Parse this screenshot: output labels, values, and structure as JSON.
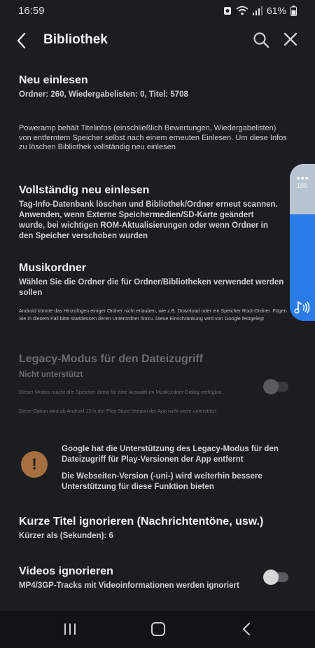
{
  "status": {
    "time": "16:59",
    "battery": "61%"
  },
  "appbar": {
    "title": "Bibliothek"
  },
  "sections": {
    "rescan": {
      "title": "Neu einlesen",
      "summary": "Ordner: 260, Wiedergabelisten: 0, Titel: 5708",
      "note": "Poweramp behält Titelinfos (einschließlich Bewertungen, Wiedergabelisten) von entferntem Speicher selbst nach einem erneuten Einlesen. Um diese Infos zu löschen Bibliothek vollständig neu einlesen"
    },
    "full_rescan": {
      "title": "Vollständig neu einlesen",
      "summary": "Tag-Info-Datenbank löschen und Bibliothek/Ordner erneut scannen. Anwenden, wenn Externe Speichermedien/SD-Karte geändert wurde, bei wichtigen ROM-Aktualisierungen oder wenn Ordner in den Speicher verschoben wurden"
    },
    "music_folders": {
      "title": "Musikordner",
      "summary": "Wählen Sie die Ordner die für Ordner/Bibliotheken verwendet werden sollen",
      "note": "Android könnte das Hinzufügen einiger Ordner nicht erlauben, wie z.B. Download oder ein Speicher Root-Ordner. Fügen Sie in diesem Fall bitte stattdessen deren Unterordner hinzu. Diese Einschränkung wird von Google festgelegt"
    },
    "legacy": {
      "title": "Legacy-Modus für den Dateizugriff",
      "summary": "Nicht unterstützt",
      "note1": "Dieser Modus macht alle Speicher direkt für eine Auswahl im Musikordner-Dialog verfügbar.",
      "note2": "Diese Option wird ab Android 13 in der Play Store Version der App nicht mehr unterstützt",
      "enabled": false
    },
    "warning": {
      "icon": "exclamation-icon",
      "text1": "Google hat die Unterstützung des Legacy-Modus für den Dateizugriff für Play-Versionen der App entfernt",
      "text2": "Die Webseiten-Version (-uni-) wird weiterhin bessere Unterstützung für diese Funktion bieten",
      "color": "#a66f3f"
    },
    "short_titles": {
      "title": "Kurze Titel ignorieren (Nachrichtentöne, usw.)",
      "summary": "Kürzer als (Sekunden): 6"
    },
    "videos": {
      "title": "Videos ignorieren",
      "summary": "MP4/3GP-Tracks mit Videoinformationen werden ignoriert",
      "enabled": false
    }
  },
  "volume_panel": {
    "level_label": "100",
    "level": 0.68,
    "accent": "#2b7ce6"
  }
}
